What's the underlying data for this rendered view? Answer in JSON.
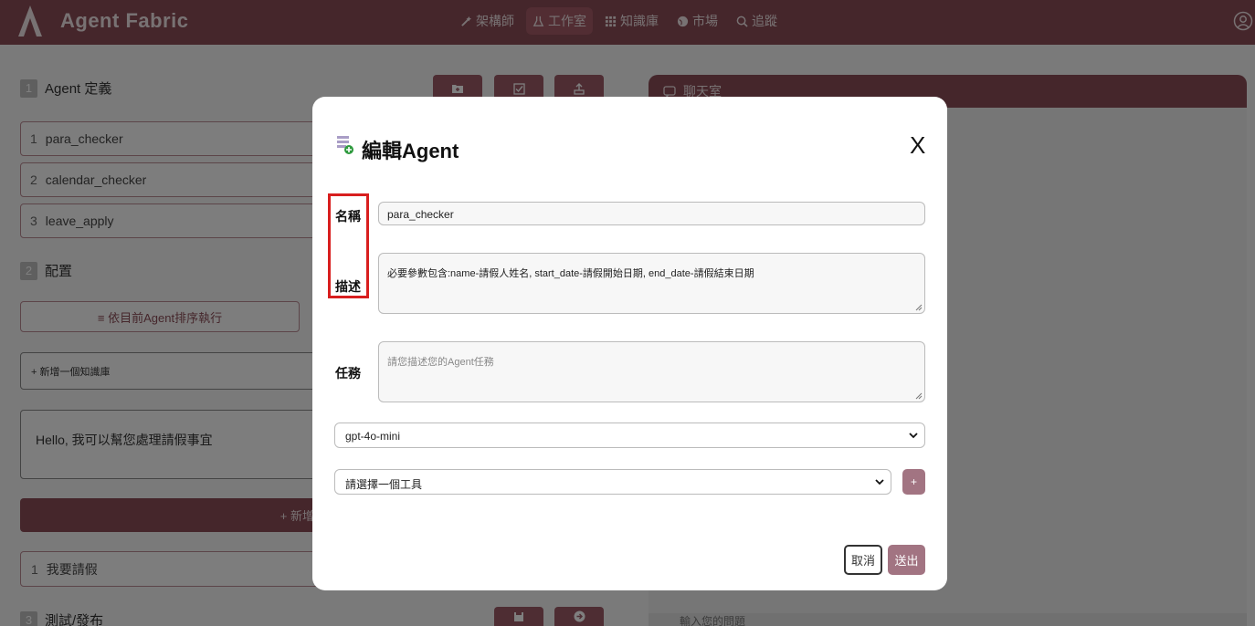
{
  "header": {
    "brand": "Agent Fabric",
    "nav": [
      {
        "label": "架構師",
        "icon": "wand-icon"
      },
      {
        "label": "工作室",
        "icon": "lab-icon",
        "active": true
      },
      {
        "label": "知識庫",
        "icon": "grid-icon"
      },
      {
        "label": "市場",
        "icon": "globe-icon"
      },
      {
        "label": "追蹤",
        "icon": "search-icon"
      }
    ]
  },
  "left": {
    "section1": {
      "num": "1",
      "title": "Agent 定義"
    },
    "agents": [
      {
        "idx": "1",
        "name": "para_checker"
      },
      {
        "idx": "2",
        "name": "calendar_checker"
      },
      {
        "idx": "3",
        "name": "leave_apply"
      }
    ],
    "section2": {
      "num": "2",
      "title": "配置"
    },
    "order_button": "≡ 依目前Agent排序執行",
    "kb_select": "+ 新增一個知識庫",
    "greeting": "Hello, 我可以幫您處理請假事宜",
    "add_button": "+ 新增",
    "query": {
      "idx": "1",
      "text": "我要請假"
    },
    "section3": {
      "num": "3",
      "title": "測試/發布"
    }
  },
  "chat": {
    "title": "聊天室",
    "input_placeholder": "輸入您的問題"
  },
  "modal": {
    "title": "編輯Agent",
    "close": "X",
    "name_label": "名稱",
    "name_value": "para_checker",
    "desc_label": "描述",
    "desc_value": "必要參數包含:name-請假人姓名, start_date-請假開始日期, end_date-請假結束日期",
    "task_label": "任務",
    "task_placeholder": "請您描述您的Agent任務",
    "model_value": "gpt-4o-mini",
    "tool_placeholder": "請選擇一個工具",
    "add_tool": "+",
    "cancel": "取消",
    "submit": "送出"
  },
  "colors": {
    "brand": "#8a4c57",
    "accent": "#a27482",
    "highlight": "#d81e1e"
  }
}
